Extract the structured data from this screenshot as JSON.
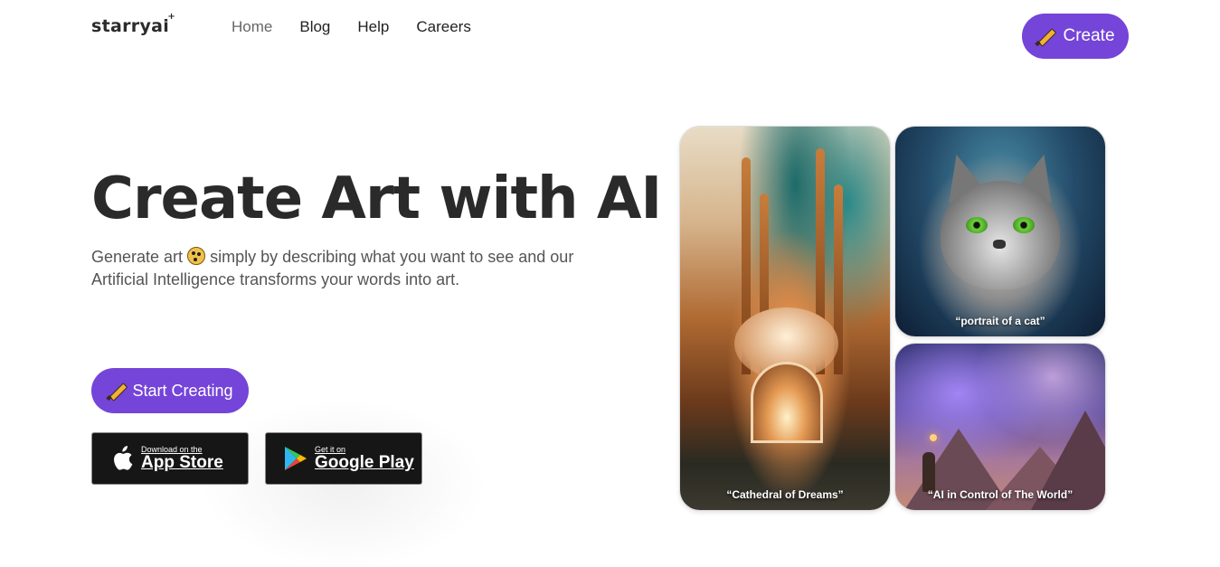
{
  "brand": {
    "logo": "starryai",
    "logo_spark": "+"
  },
  "nav": {
    "items": [
      {
        "label": "Home",
        "active": true
      },
      {
        "label": "Blog",
        "active": false
      },
      {
        "label": "Help",
        "active": false
      },
      {
        "label": "Careers",
        "active": false
      }
    ]
  },
  "header": {
    "create_label": "Create"
  },
  "hero": {
    "title": "Create Art with AI",
    "subtitle_part1": "Generate art",
    "subtitle_part2": "simply by describing what you want to see and our Artificial Intelligence transforms your words into art.",
    "start_label": "Start Creating"
  },
  "stores": {
    "apple": {
      "small": "Download on the",
      "big": "App Store"
    },
    "google": {
      "small": "Get it on",
      "big": "Google Play"
    }
  },
  "gallery": [
    {
      "caption": "“Cathedral of Dreams”"
    },
    {
      "caption": "“portrait of a cat”"
    },
    {
      "caption": "“AI in Control of The World”"
    }
  ],
  "colors": {
    "accent": "#7544d8",
    "text": "#2a2a2a",
    "muted": "#555555"
  }
}
